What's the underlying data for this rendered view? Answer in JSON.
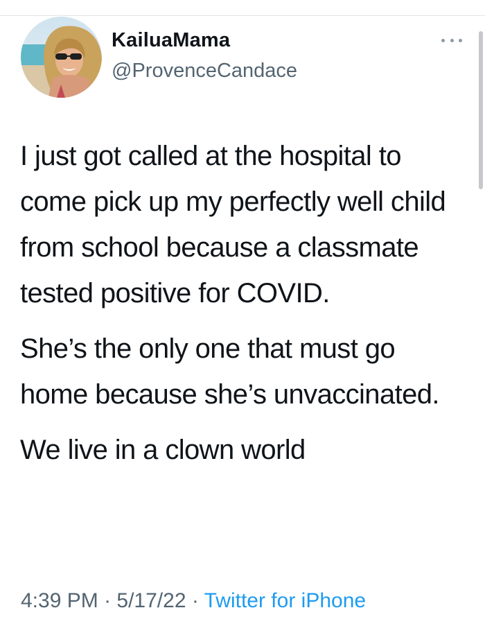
{
  "author": {
    "display_name": "KailuaMama",
    "handle": "@ProvenceCandace",
    "avatar_icon": "profile-photo"
  },
  "menu": {
    "more_icon": "more-horizontal-icon"
  },
  "tweet": {
    "paragraphs": [
      "I just got called at the hospital to come pick up my perfectly well child from school because a classmate tested positive for COVID.",
      "She’s the only one that must go home because she’s unvaccinated.",
      "We live in a clown world"
    ]
  },
  "meta": {
    "time": "4:39 PM",
    "sep1": " · ",
    "date": "5/17/22",
    "sep2": " · ",
    "source": "Twitter for iPhone"
  },
  "colors": {
    "text_primary": "#0f1419",
    "text_secondary": "#536471",
    "link": "#1d9bf0"
  }
}
